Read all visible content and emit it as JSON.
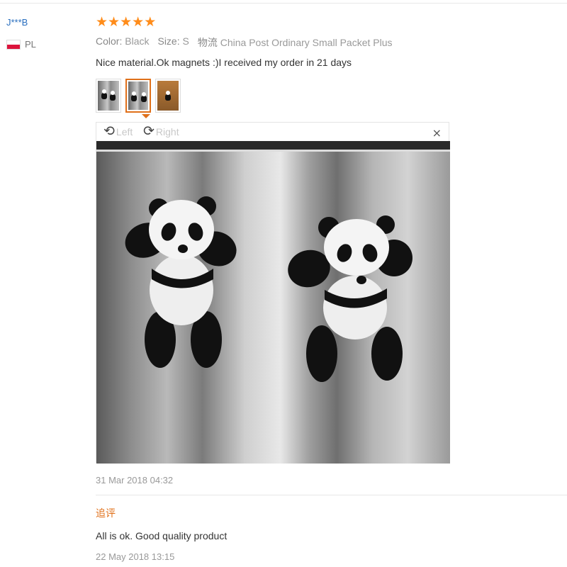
{
  "user": {
    "name": "J***B",
    "country": "PL"
  },
  "rating": {
    "stars": 5,
    "icon": "star-icon",
    "color": "#ff8c1a"
  },
  "attributes": {
    "color_label": "Color:",
    "color_value": "Black",
    "size_label": "Size:",
    "size_value": "S",
    "shipping_label": "物流",
    "shipping_value": "China Post Ordinary Small Packet Plus"
  },
  "review_text": "Nice material.Ok magnets :)I received my order in 21 days",
  "thumbnails": [
    {
      "active": false
    },
    {
      "active": true
    },
    {
      "active": false
    }
  ],
  "viewer": {
    "rotate_left_label": "Left",
    "rotate_right_label": "Right",
    "close_label": "×"
  },
  "review_date": "31 Mar 2018 04:32",
  "followup": {
    "label": "追评",
    "text": "All is ok. Good quality product",
    "date": "22 May 2018 13:15"
  },
  "colors": {
    "accent": "#e0701a",
    "username": "#2a6fbf"
  }
}
